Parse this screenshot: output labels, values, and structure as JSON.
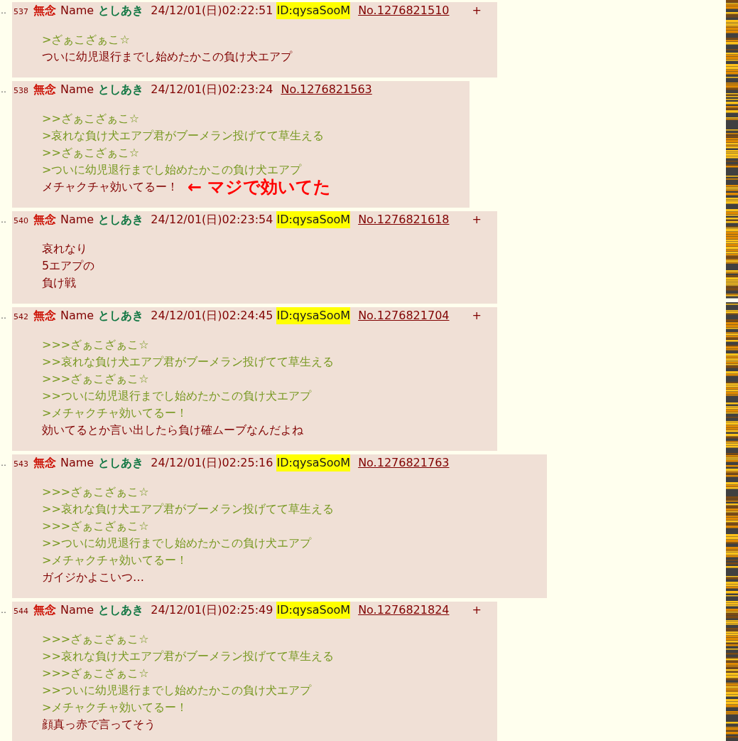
{
  "thread": {
    "posts": [
      {
        "marker": "‥",
        "number": "537",
        "subject": "無念",
        "name_label": "Name",
        "name": "としあき",
        "date": "24/12/01(日)02:22:51",
        "id": "ID:qysaSooM",
        "post_no": "No.1276821510",
        "menu": "+",
        "lines": [
          {
            "kind": "quote",
            "text": ">ざぁこざぁこ☆"
          },
          {
            "kind": "text",
            "text": "ついに幼児退行までし始めたかこの負け犬エアプ"
          }
        ]
      },
      {
        "marker": "‥",
        "number": "538",
        "subject": "無念",
        "name_label": "Name",
        "name": "としあき",
        "date": "24/12/01(日)02:23:24",
        "post_no": "No.1276821563",
        "lines": [
          {
            "kind": "quote",
            "text": ">>ざぁこざぁこ☆"
          },
          {
            "kind": "quote",
            "text": ">哀れな負け犬エアプ君がブーメラン投げてて草生える"
          },
          {
            "kind": "quote",
            "text": ">>ざぁこざぁこ☆"
          },
          {
            "kind": "quote",
            "text": ">ついに幼児退行までし始めたかこの負け犬エアプ"
          },
          {
            "kind": "text",
            "text": "メチャクチャ効いてるー！",
            "annotation": "← マジで効いてた"
          }
        ]
      },
      {
        "marker": "‥",
        "number": "540",
        "subject": "無念",
        "name_label": "Name",
        "name": "としあき",
        "date": "24/12/01(日)02:23:54",
        "id": "ID:qysaSooM",
        "post_no": "No.1276821618",
        "menu": "+",
        "lines": [
          {
            "kind": "text",
            "text": "哀れなり"
          },
          {
            "kind": "text",
            "text": "5エアプの"
          },
          {
            "kind": "text",
            "text": "負け戦"
          }
        ]
      },
      {
        "marker": "‥",
        "number": "542",
        "subject": "無念",
        "name_label": "Name",
        "name": "としあき",
        "date": "24/12/01(日)02:24:45",
        "id": "ID:qysaSooM",
        "post_no": "No.1276821704",
        "menu": "+",
        "lines": [
          {
            "kind": "quote",
            "text": ">>>ざぁこざぁこ☆"
          },
          {
            "kind": "quote",
            "text": ">>哀れな負け犬エアプ君がブーメラン投げてて草生える"
          },
          {
            "kind": "quote",
            "text": ">>>ざぁこざぁこ☆"
          },
          {
            "kind": "quote",
            "text": ">>ついに幼児退行までし始めたかこの負け犬エアプ"
          },
          {
            "kind": "quote",
            "text": ">メチャクチャ効いてるー！"
          },
          {
            "kind": "text",
            "text": "効いてるとか言い出したら負け確ムーブなんだよね"
          }
        ]
      },
      {
        "marker": "‥",
        "number": "543",
        "subject": "無念",
        "name_label": "Name",
        "name": "としあき",
        "date": "24/12/01(日)02:25:16",
        "id": "ID:qysaSooM",
        "post_no": "No.1276821763",
        "lines": [
          {
            "kind": "quote",
            "text": ">>>ざぁこざぁこ☆"
          },
          {
            "kind": "quote",
            "text": ">>哀れな負け犬エアプ君がブーメラン投げてて草生える"
          },
          {
            "kind": "quote",
            "text": ">>>ざぁこざぁこ☆"
          },
          {
            "kind": "quote",
            "text": ">>ついに幼児退行までし始めたかこの負け犬エアプ"
          },
          {
            "kind": "quote",
            "text": ">メチャクチャ効いてるー！"
          },
          {
            "kind": "text",
            "text": "ガイジかよこいつ…"
          }
        ]
      },
      {
        "marker": "‥",
        "number": "544",
        "subject": "無念",
        "name_label": "Name",
        "name": "としあき",
        "date": "24/12/01(日)02:25:49",
        "id": "ID:qysaSooM",
        "post_no": "No.1276821824",
        "menu": "+",
        "lines": [
          {
            "kind": "quote",
            "text": ">>>ざぁこざぁこ☆"
          },
          {
            "kind": "quote",
            "text": ">>哀れな負け犬エアプ君がブーメラン投げてて草生える"
          },
          {
            "kind": "quote",
            "text": ">>>ざぁこざぁこ☆"
          },
          {
            "kind": "quote",
            "text": ">>ついに幼児退行までし始めたかこの負け犬エアプ"
          },
          {
            "kind": "quote",
            "text": ">メチャクチャ効いてるー！"
          },
          {
            "kind": "text",
            "text": "顔真っ赤で言ってそう"
          }
        ]
      }
    ]
  }
}
